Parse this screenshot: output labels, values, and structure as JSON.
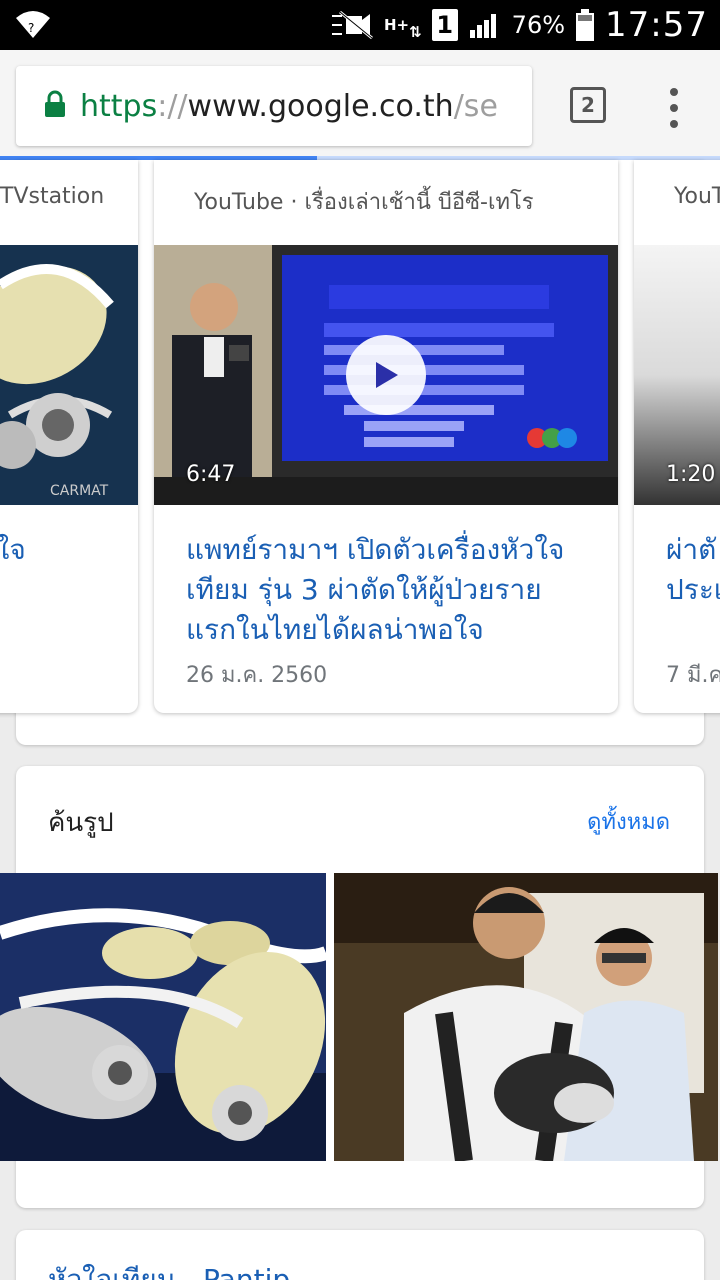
{
  "status_bar": {
    "battery": "76%",
    "sim_slot": "1",
    "network": "H+",
    "time": "17:57"
  },
  "browser": {
    "url_scheme": "https",
    "url_slashes": "://",
    "url_host": "www.google.co.th",
    "url_rest": "/se",
    "tab_count": "2",
    "page_load_progress": 0.44
  },
  "video_carousel": {
    "cards": [
      {
        "source": "TVstation",
        "duration": "",
        "title": "วใจ",
        "date": ""
      },
      {
        "source": "YouTube · เรื่องเล่าเช้านี้ บีอีซี-เทโร",
        "duration": "6:47",
        "title_lines": [
          "แพทย์รามาฯ เปิดตัวเครื่องหัวใจ",
          "เทียม รุ่น 3 ผ่าตัดให้ผู้ป่วยราย",
          "แรกในไทยได้ผลน่าพอใจ"
        ],
        "date": "26 ม.ค. 2560"
      },
      {
        "source": "YouT",
        "duration": "1:20",
        "title_lines": [
          "ผ่าตั",
          "ประเ"
        ],
        "date": "7 มี.ค"
      }
    ]
  },
  "image_section": {
    "heading": "ค้นรูป",
    "see_all": "ดูทั้งหมด"
  },
  "next_result": {
    "title": "หัวใจเทียม - Pantip"
  },
  "colors": {
    "link": "#1a5fb4",
    "secure": "#0b8043",
    "progress": "#4285f4"
  }
}
